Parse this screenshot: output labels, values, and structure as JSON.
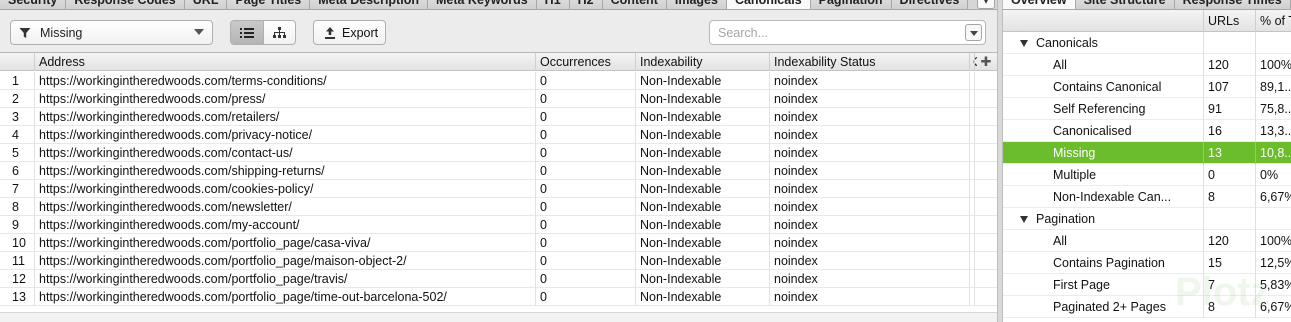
{
  "tabs": [
    "Security",
    "Response Codes",
    "URL",
    "Page Titles",
    "Meta Description",
    "Meta Keywords",
    "H1",
    "H2",
    "Content",
    "Images",
    "Canonicals",
    "Pagination",
    "Directives"
  ],
  "active_tab": "Canonicals",
  "toolbar": {
    "filter_value": "Missing",
    "export_label": "Export",
    "search_placeholder": "Search..."
  },
  "table": {
    "columns": [
      "",
      "Address",
      "Occurrences",
      "Indexability",
      "Indexability Status",
      "C"
    ],
    "rows": [
      {
        "n": "1",
        "address": "https://workingintheredwoods.com/terms-conditions/",
        "occurrences": "0",
        "indexability": "Non-Indexable",
        "status": "noindex"
      },
      {
        "n": "2",
        "address": "https://workingintheredwoods.com/press/",
        "occurrences": "0",
        "indexability": "Non-Indexable",
        "status": "noindex"
      },
      {
        "n": "3",
        "address": "https://workingintheredwoods.com/retailers/",
        "occurrences": "0",
        "indexability": "Non-Indexable",
        "status": "noindex"
      },
      {
        "n": "4",
        "address": "https://workingintheredwoods.com/privacy-notice/",
        "occurrences": "0",
        "indexability": "Non-Indexable",
        "status": "noindex"
      },
      {
        "n": "5",
        "address": "https://workingintheredwoods.com/contact-us/",
        "occurrences": "0",
        "indexability": "Non-Indexable",
        "status": "noindex"
      },
      {
        "n": "6",
        "address": "https://workingintheredwoods.com/shipping-returns/",
        "occurrences": "0",
        "indexability": "Non-Indexable",
        "status": "noindex"
      },
      {
        "n": "7",
        "address": "https://workingintheredwoods.com/cookies-policy/",
        "occurrences": "0",
        "indexability": "Non-Indexable",
        "status": "noindex"
      },
      {
        "n": "8",
        "address": "https://workingintheredwoods.com/newsletter/",
        "occurrences": "0",
        "indexability": "Non-Indexable",
        "status": "noindex"
      },
      {
        "n": "9",
        "address": "https://workingintheredwoods.com/my-account/",
        "occurrences": "0",
        "indexability": "Non-Indexable",
        "status": "noindex"
      },
      {
        "n": "10",
        "address": "https://workingintheredwoods.com/portfolio_page/casa-viva/",
        "occurrences": "0",
        "indexability": "Non-Indexable",
        "status": "noindex"
      },
      {
        "n": "11",
        "address": "https://workingintheredwoods.com/portfolio_page/maison-object-2/",
        "occurrences": "0",
        "indexability": "Non-Indexable",
        "status": "noindex"
      },
      {
        "n": "12",
        "address": "https://workingintheredwoods.com/portfolio_page/travis/",
        "occurrences": "0",
        "indexability": "Non-Indexable",
        "status": "noindex"
      },
      {
        "n": "13",
        "address": "https://workingintheredwoods.com/portfolio_page/time-out-barcelona-502/",
        "occurrences": "0",
        "indexability": "Non-Indexable",
        "status": "noindex"
      }
    ]
  },
  "right": {
    "tabs": [
      "Overview",
      "Site Structure",
      "Response Times"
    ],
    "active_tab": "Overview",
    "columns": {
      "urls": "URLs",
      "pct": "% of T"
    },
    "rows": [
      {
        "label": "Canonicals",
        "urls": "",
        "pct": "",
        "group": true
      },
      {
        "label": "All",
        "urls": "120",
        "pct": "100%"
      },
      {
        "label": "Contains Canonical",
        "urls": "107",
        "pct": "89,1..."
      },
      {
        "label": "Self Referencing",
        "urls": "91",
        "pct": "75,8..."
      },
      {
        "label": "Canonicalised",
        "urls": "16",
        "pct": "13,3..."
      },
      {
        "label": "Missing",
        "urls": "13",
        "pct": "10,8...",
        "selected": true
      },
      {
        "label": "Multiple",
        "urls": "0",
        "pct": "0%"
      },
      {
        "label": "Non-Indexable Can...",
        "urls": "8",
        "pct": "6,67%"
      },
      {
        "label": "Pagination",
        "urls": "",
        "pct": "",
        "group": true
      },
      {
        "label": "All",
        "urls": "120",
        "pct": "100%"
      },
      {
        "label": "Contains Pagination",
        "urls": "15",
        "pct": "12,5%"
      },
      {
        "label": "First Page",
        "urls": "7",
        "pct": "5,83%"
      },
      {
        "label": "Paginated 2+ Pages",
        "urls": "8",
        "pct": "6,67%"
      }
    ]
  },
  "colors": {
    "selected_row": "#6bbd2b",
    "header_bg": "#e3e3e3"
  },
  "watermark": "Plotz"
}
